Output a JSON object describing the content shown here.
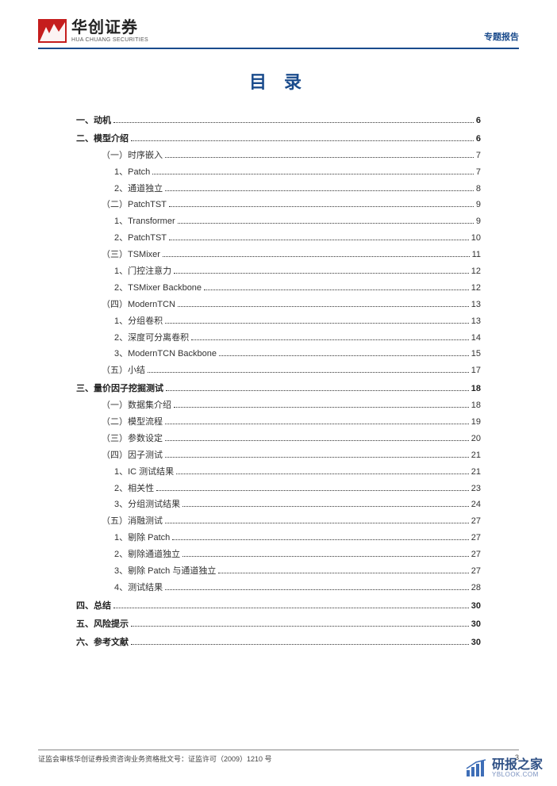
{
  "header": {
    "logo_cn": "华创证券",
    "logo_en": "HUA CHUANG SECURITIES",
    "doc_type": "专题报告"
  },
  "toc_title": "目 录",
  "toc": [
    {
      "level": 0,
      "label": "一、动机",
      "page": "6"
    },
    {
      "level": 0,
      "label": "二、模型介绍",
      "page": "6"
    },
    {
      "level": 1,
      "label": "（一）时序嵌入",
      "page": "7"
    },
    {
      "level": 2,
      "label": "1、Patch",
      "page": "7"
    },
    {
      "level": 2,
      "label": "2、通道独立",
      "page": "8"
    },
    {
      "level": 1,
      "label": "（二）PatchTST",
      "page": "9"
    },
    {
      "level": 2,
      "label": "1、Transformer",
      "page": "9"
    },
    {
      "level": 2,
      "label": "2、PatchTST",
      "page": "10"
    },
    {
      "level": 1,
      "label": "（三）TSMixer",
      "page": "11"
    },
    {
      "level": 2,
      "label": "1、门控注意力",
      "page": "12"
    },
    {
      "level": 2,
      "label": "2、TSMixer Backbone",
      "page": "12"
    },
    {
      "level": 1,
      "label": "（四）ModernTCN",
      "page": "13"
    },
    {
      "level": 2,
      "label": "1、分组卷积",
      "page": "13"
    },
    {
      "level": 2,
      "label": "2、深度可分离卷积",
      "page": "14"
    },
    {
      "level": 2,
      "label": "3、ModernTCN Backbone",
      "page": "15"
    },
    {
      "level": 1,
      "label": "（五）小结",
      "page": "17"
    },
    {
      "level": 0,
      "label": "三、量价因子挖掘测试",
      "page": "18"
    },
    {
      "level": 1,
      "label": "（一）数据集介绍",
      "page": "18"
    },
    {
      "level": 1,
      "label": "（二）模型流程",
      "page": "19"
    },
    {
      "level": 1,
      "label": "（三）参数设定",
      "page": "20"
    },
    {
      "level": 1,
      "label": "（四）因子测试",
      "page": "21"
    },
    {
      "level": 2,
      "label": "1、IC 测试结果",
      "page": "21"
    },
    {
      "level": 2,
      "label": "2、相关性",
      "page": "23"
    },
    {
      "level": 2,
      "label": "3、分组测试结果",
      "page": "24"
    },
    {
      "level": 1,
      "label": "（五）消融测试",
      "page": "27"
    },
    {
      "level": 2,
      "label": "1、剔除 Patch",
      "page": "27"
    },
    {
      "level": 2,
      "label": "2、剔除通道独立",
      "page": "27"
    },
    {
      "level": 2,
      "label": "3、剔除 Patch 与通道独立",
      "page": "27"
    },
    {
      "level": 2,
      "label": "4、测试结果",
      "page": "28"
    },
    {
      "level": 0,
      "label": "四、总结",
      "page": "30"
    },
    {
      "level": 0,
      "label": "五、风险提示",
      "page": "30"
    },
    {
      "level": 0,
      "label": "六、参考文献",
      "page": "30"
    }
  ],
  "footer": {
    "left": "证监会审核华创证券投资咨询业务资格批文号：证监许可（2009）1210 号",
    "right": "3"
  },
  "watermark": {
    "cn": "研报之家",
    "en": "YBLOOK.COM"
  }
}
